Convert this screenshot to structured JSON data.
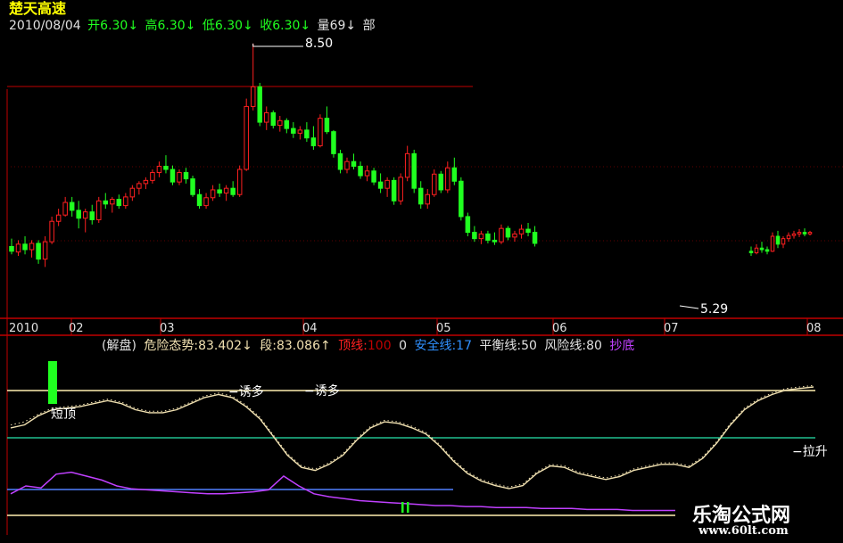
{
  "stock": {
    "name": "楚天高速",
    "date": "2010/08/04",
    "open": "开6.30↓",
    "high": "高6.30↓",
    "low": "低6.30↓",
    "close": "收6.30↓",
    "volume": "量69↓",
    "extra": "部"
  },
  "price_marks": {
    "high": "8.50",
    "low": "5.29"
  },
  "time_axis": [
    "2010",
    "02",
    "03",
    "04",
    "05",
    "06",
    "07",
    "08"
  ],
  "indicator": {
    "prefix": "(解盘)",
    "danger_label": "危险态势:83.402↓",
    "segment_label": "段:83.086↑",
    "top_line_name": "顶线:",
    "top_line_value": "100",
    "zero": "0",
    "safe_line": "安全线:17",
    "balance_line": "平衡线:50",
    "risk_line": "风险线:80",
    "bottom_label": "抄底"
  },
  "annotations": {
    "short_top": "短顶",
    "lure1": "−诱多",
    "lure2": "−诱多",
    "rise": "−拉升"
  },
  "watermark": {
    "name": "乐淘公式网",
    "url": "www.60lt.com"
  },
  "colors": {
    "background": "#000000",
    "up": "#ff2020",
    "down": "#20ff20",
    "frame": "#c00000",
    "curve": "#f0e0b0",
    "purple": "#c040ff",
    "blue_line": "#5080ff",
    "teal_line": "#20c090",
    "yellow_line": "#fff0b0"
  },
  "chart_data": {
    "type": "candlestick",
    "ylim": [
      5.2,
      8.6
    ],
    "candles": [
      {
        "o": 5.92,
        "h": 6.02,
        "l": 5.82,
        "c": 5.86
      },
      {
        "o": 5.85,
        "h": 6.0,
        "l": 5.8,
        "c": 5.95
      },
      {
        "o": 5.95,
        "h": 6.05,
        "l": 5.82,
        "c": 5.88
      },
      {
        "o": 5.88,
        "h": 6.0,
        "l": 5.78,
        "c": 5.96
      },
      {
        "o": 5.96,
        "h": 6.0,
        "l": 5.7,
        "c": 5.76
      },
      {
        "o": 5.76,
        "h": 6.05,
        "l": 5.66,
        "c": 5.98
      },
      {
        "o": 5.98,
        "h": 6.3,
        "l": 5.95,
        "c": 6.24
      },
      {
        "o": 6.24,
        "h": 6.4,
        "l": 6.18,
        "c": 6.32
      },
      {
        "o": 6.32,
        "h": 6.55,
        "l": 6.3,
        "c": 6.48
      },
      {
        "o": 6.48,
        "h": 6.55,
        "l": 6.3,
        "c": 6.38
      },
      {
        "o": 6.38,
        "h": 6.5,
        "l": 6.15,
        "c": 6.28
      },
      {
        "o": 6.28,
        "h": 6.4,
        "l": 6.1,
        "c": 6.36
      },
      {
        "o": 6.36,
        "h": 6.45,
        "l": 6.2,
        "c": 6.26
      },
      {
        "o": 6.26,
        "h": 6.55,
        "l": 6.22,
        "c": 6.5
      },
      {
        "o": 6.5,
        "h": 6.6,
        "l": 6.4,
        "c": 6.46
      },
      {
        "o": 6.46,
        "h": 6.55,
        "l": 6.35,
        "c": 6.52
      },
      {
        "o": 6.52,
        "h": 6.58,
        "l": 6.4,
        "c": 6.44
      },
      {
        "o": 6.44,
        "h": 6.6,
        "l": 6.4,
        "c": 6.55
      },
      {
        "o": 6.55,
        "h": 6.7,
        "l": 6.5,
        "c": 6.66
      },
      {
        "o": 6.66,
        "h": 6.75,
        "l": 6.58,
        "c": 6.72
      },
      {
        "o": 6.72,
        "h": 6.8,
        "l": 6.65,
        "c": 6.76
      },
      {
        "o": 6.76,
        "h": 6.9,
        "l": 6.72,
        "c": 6.86
      },
      {
        "o": 6.86,
        "h": 7.0,
        "l": 6.8,
        "c": 6.94
      },
      {
        "o": 6.94,
        "h": 7.08,
        "l": 6.85,
        "c": 6.9
      },
      {
        "o": 6.9,
        "h": 6.95,
        "l": 6.7,
        "c": 6.74
      },
      {
        "o": 6.74,
        "h": 6.9,
        "l": 6.7,
        "c": 6.86
      },
      {
        "o": 6.86,
        "h": 6.92,
        "l": 6.72,
        "c": 6.78
      },
      {
        "o": 6.78,
        "h": 6.82,
        "l": 6.55,
        "c": 6.58
      },
      {
        "o": 6.58,
        "h": 6.65,
        "l": 6.4,
        "c": 6.44
      },
      {
        "o": 6.44,
        "h": 6.6,
        "l": 6.4,
        "c": 6.54
      },
      {
        "o": 6.54,
        "h": 6.7,
        "l": 6.5,
        "c": 6.64
      },
      {
        "o": 6.64,
        "h": 6.72,
        "l": 6.55,
        "c": 6.6
      },
      {
        "o": 6.6,
        "h": 6.7,
        "l": 6.5,
        "c": 6.66
      },
      {
        "o": 6.66,
        "h": 6.75,
        "l": 6.55,
        "c": 6.58
      },
      {
        "o": 6.58,
        "h": 6.95,
        "l": 6.55,
        "c": 6.9
      },
      {
        "o": 6.9,
        "h": 7.8,
        "l": 6.88,
        "c": 7.7
      },
      {
        "o": 7.7,
        "h": 8.5,
        "l": 7.65,
        "c": 7.95
      },
      {
        "o": 7.95,
        "h": 8.0,
        "l": 7.45,
        "c": 7.5
      },
      {
        "o": 7.5,
        "h": 7.7,
        "l": 7.4,
        "c": 7.62
      },
      {
        "o": 7.62,
        "h": 7.65,
        "l": 7.42,
        "c": 7.46
      },
      {
        "o": 7.46,
        "h": 7.58,
        "l": 7.38,
        "c": 7.52
      },
      {
        "o": 7.52,
        "h": 7.55,
        "l": 7.36,
        "c": 7.42
      },
      {
        "o": 7.42,
        "h": 7.5,
        "l": 7.3,
        "c": 7.36
      },
      {
        "o": 7.36,
        "h": 7.45,
        "l": 7.28,
        "c": 7.4
      },
      {
        "o": 7.4,
        "h": 7.5,
        "l": 7.25,
        "c": 7.3
      },
      {
        "o": 7.3,
        "h": 7.45,
        "l": 7.15,
        "c": 7.2
      },
      {
        "o": 7.2,
        "h": 7.6,
        "l": 7.18,
        "c": 7.55
      },
      {
        "o": 7.55,
        "h": 7.7,
        "l": 7.35,
        "c": 7.38
      },
      {
        "o": 7.38,
        "h": 7.4,
        "l": 7.05,
        "c": 7.1
      },
      {
        "o": 7.1,
        "h": 7.15,
        "l": 6.85,
        "c": 6.9
      },
      {
        "o": 6.9,
        "h": 7.05,
        "l": 6.85,
        "c": 7.0
      },
      {
        "o": 7.0,
        "h": 7.1,
        "l": 6.9,
        "c": 6.94
      },
      {
        "o": 6.94,
        "h": 7.0,
        "l": 6.78,
        "c": 6.82
      },
      {
        "o": 6.82,
        "h": 6.95,
        "l": 6.75,
        "c": 6.88
      },
      {
        "o": 6.88,
        "h": 6.92,
        "l": 6.7,
        "c": 6.74
      },
      {
        "o": 6.74,
        "h": 6.85,
        "l": 6.6,
        "c": 6.66
      },
      {
        "o": 6.66,
        "h": 6.8,
        "l": 6.55,
        "c": 6.76
      },
      {
        "o": 6.76,
        "h": 6.8,
        "l": 6.45,
        "c": 6.5
      },
      {
        "o": 6.5,
        "h": 6.85,
        "l": 6.45,
        "c": 6.8
      },
      {
        "o": 6.8,
        "h": 7.2,
        "l": 6.75,
        "c": 7.1
      },
      {
        "o": 7.1,
        "h": 7.15,
        "l": 6.6,
        "c": 6.66
      },
      {
        "o": 6.66,
        "h": 6.75,
        "l": 6.4,
        "c": 6.46
      },
      {
        "o": 6.46,
        "h": 6.65,
        "l": 6.4,
        "c": 6.58
      },
      {
        "o": 6.58,
        "h": 6.9,
        "l": 6.55,
        "c": 6.84
      },
      {
        "o": 6.84,
        "h": 6.88,
        "l": 6.6,
        "c": 6.64
      },
      {
        "o": 6.64,
        "h": 7.0,
        "l": 6.6,
        "c": 6.92
      },
      {
        "o": 6.92,
        "h": 7.05,
        "l": 6.7,
        "c": 6.75
      },
      {
        "o": 6.75,
        "h": 6.8,
        "l": 6.25,
        "c": 6.3
      },
      {
        "o": 6.3,
        "h": 6.35,
        "l": 6.05,
        "c": 6.1
      },
      {
        "o": 6.1,
        "h": 6.18,
        "l": 5.98,
        "c": 6.02
      },
      {
        "o": 6.02,
        "h": 6.12,
        "l": 5.95,
        "c": 6.08
      },
      {
        "o": 6.08,
        "h": 6.12,
        "l": 5.96,
        "c": 6.0
      },
      {
        "o": 6.0,
        "h": 6.1,
        "l": 5.94,
        "c": 5.98
      },
      {
        "o": 5.98,
        "h": 6.2,
        "l": 5.95,
        "c": 6.15
      },
      {
        "o": 6.15,
        "h": 6.18,
        "l": 6.0,
        "c": 6.04
      },
      {
        "o": 6.04,
        "h": 6.12,
        "l": 5.98,
        "c": 6.08
      },
      {
        "o": 6.08,
        "h": 6.2,
        "l": 6.02,
        "c": 6.14
      },
      {
        "o": 6.14,
        "h": 6.22,
        "l": 6.05,
        "c": 6.1
      },
      {
        "o": 6.1,
        "h": 6.18,
        "l": 5.92,
        "c": 5.96
      }
    ],
    "recent_candles": [
      {
        "o": 5.86,
        "h": 5.92,
        "l": 5.8,
        "c": 5.84
      },
      {
        "o": 5.84,
        "h": 5.95,
        "l": 5.82,
        "c": 5.9
      },
      {
        "o": 5.9,
        "h": 5.98,
        "l": 5.84,
        "c": 5.88
      },
      {
        "o": 5.88,
        "h": 5.92,
        "l": 5.82,
        "c": 5.86
      },
      {
        "o": 5.86,
        "h": 6.1,
        "l": 5.85,
        "c": 6.05
      },
      {
        "o": 6.05,
        "h": 6.12,
        "l": 5.9,
        "c": 5.95
      },
      {
        "o": 5.95,
        "h": 6.05,
        "l": 5.9,
        "c": 6.02
      },
      {
        "o": 6.02,
        "h": 6.1,
        "l": 5.98,
        "c": 6.06
      },
      {
        "o": 6.06,
        "h": 6.12,
        "l": 6.02,
        "c": 6.08
      },
      {
        "o": 6.08,
        "h": 6.14,
        "l": 6.04,
        "c": 6.1
      },
      {
        "o": 6.1,
        "h": 6.15,
        "l": 6.05,
        "c": 6.08
      },
      {
        "o": 6.08,
        "h": 6.12,
        "l": 6.06,
        "c": 6.1
      }
    ],
    "indicator_lines": {
      "top": 100,
      "risk": 80,
      "balance": 50,
      "safe": 17,
      "bottom": 0
    },
    "indicator_ylim": [
      0,
      100
    ],
    "danger_curve": [
      70,
      72,
      78,
      82,
      83,
      84,
      86,
      88,
      86,
      82,
      80,
      80,
      82,
      86,
      90,
      92,
      90,
      84,
      76,
      64,
      52,
      44,
      42,
      46,
      52,
      62,
      70,
      74,
      73,
      70,
      66,
      58,
      48,
      40,
      35,
      32,
      30,
      32,
      40,
      45,
      44,
      40,
      38,
      36,
      38,
      42,
      44,
      46,
      46,
      44,
      50,
      60,
      72,
      82,
      88,
      92,
      95,
      96,
      97
    ],
    "segment_curve": [
      72,
      74,
      79,
      83,
      84,
      85,
      87,
      89,
      87,
      83,
      81,
      81,
      83,
      87,
      91,
      93,
      91,
      85,
      77,
      65,
      53,
      45,
      43,
      47,
      53,
      63,
      71,
      75,
      74,
      71,
      67,
      59,
      49,
      41,
      36,
      33,
      31,
      33,
      41,
      46,
      45,
      41,
      39,
      37,
      39,
      43,
      45,
      47,
      47,
      45,
      51,
      61,
      73,
      83,
      89,
      93,
      96,
      97,
      98
    ],
    "purple_curve": [
      22,
      30,
      28,
      42,
      44,
      40,
      36,
      30,
      27,
      26,
      25,
      24,
      23,
      22,
      22,
      23,
      24,
      26,
      40,
      30,
      22,
      19,
      17,
      15,
      14,
      13,
      12,
      11,
      10,
      10,
      9,
      9,
      8,
      8,
      8,
      7,
      7,
      7,
      6,
      6,
      6,
      5,
      5,
      5,
      5
    ],
    "short_top_bar": [
      88,
      70
    ],
    "green_marks": [
      2,
      2
    ]
  }
}
